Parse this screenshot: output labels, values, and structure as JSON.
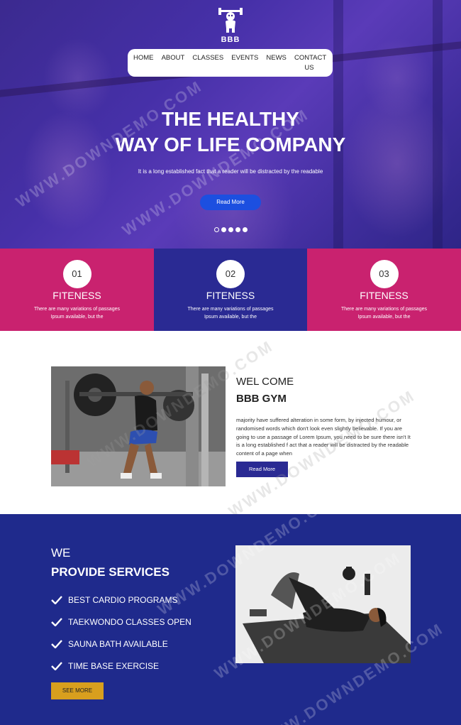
{
  "brand": {
    "name": "BBB",
    "logo_icon": "barbell-mascot-icon"
  },
  "nav": {
    "items": [
      "HOME",
      "ABOUT",
      "CLASSES",
      "EVENTS",
      "NEWS"
    ],
    "contact": "CONTACT US"
  },
  "hero": {
    "title_line1": "THE HEALTHY",
    "title_line2": "WAY OF LIFE COMPANY",
    "subtitle": "It is a long established fact that a reader will be distracted by the readable",
    "button": "Read More",
    "slides": 5,
    "active_slide": 1
  },
  "features": [
    {
      "num": "01",
      "title": "FITENESS",
      "desc_line1": "There are many variations of passages",
      "desc_line2": "Ipsum available, but the",
      "color": "#c9226f"
    },
    {
      "num": "02",
      "title": "FITENESS",
      "desc_line1": "There are many variations of passages",
      "desc_line2": "Ipsum available, but the",
      "color": "#2a2a93"
    },
    {
      "num": "03",
      "title": "FITENESS",
      "desc_line1": "There are many variations of passages",
      "desc_line2": "Ipsum available, but the",
      "color": "#c9226f"
    }
  ],
  "welcome": {
    "title1": "WEL COME",
    "title2": "BBB GYM",
    "body": "majority have suffered alteration in some form, by injected humour, or randomised words which don't look even slightly believable. If you are going to use a passage of Lorem Ipsum, you need to be sure there isn't It is a long established f act that a reader will be distracted by the readable content of a page when",
    "button": "Read More"
  },
  "services": {
    "title1": "WE",
    "title2": "PROVIDE SERVICES",
    "items": [
      "BEST CARDIO PROGRAMS",
      "TAEKWONDO CLASSES OPEN",
      "SAUNA BATH AVAILABLE",
      "TIME BASE EXERCISE"
    ],
    "button": "SEE MORE"
  },
  "watermark": "WWW.DOWNDEMO.COM",
  "colors": {
    "pink": "#c9226f",
    "navy": "#2a2a93",
    "services_bg": "#1f2a8c",
    "hero_button": "#1c4fe0",
    "gold": "#d89f1e"
  }
}
